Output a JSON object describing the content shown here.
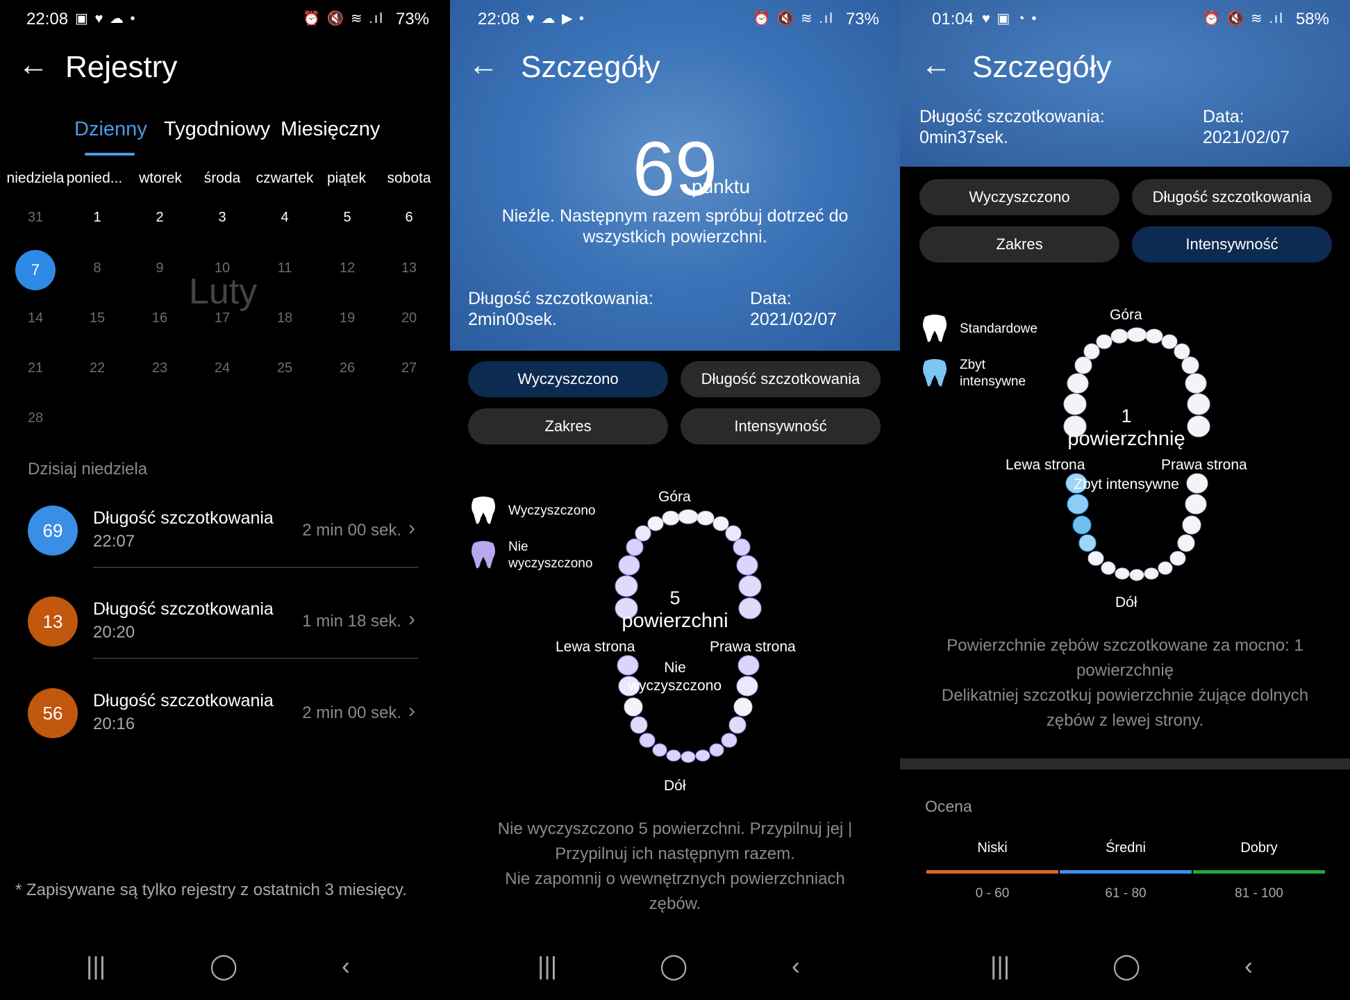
{
  "panel1": {
    "status": {
      "time": "22:08",
      "battery": "73%",
      "left_icons": "▣ ♥ ☁ •",
      "right_icons": "⏰ 🔇 ≋ .ıl"
    },
    "title": "Rejestry",
    "tabs": [
      "Dzienny",
      "Tygodniowy",
      "Miesięczny"
    ],
    "weekdays": [
      "niedziela",
      "ponied...",
      "wtorek",
      "środa",
      "czwartek",
      "piątek",
      "sobota"
    ],
    "days_row1": [
      "31",
      "1",
      "2",
      "3",
      "4",
      "5",
      "6"
    ],
    "selected_day": "7",
    "days_row2": [
      "8",
      "9",
      "10",
      "11",
      "12",
      "13"
    ],
    "days_row3": [
      "14",
      "15",
      "16",
      "17",
      "18",
      "19",
      "20"
    ],
    "days_row4": [
      "21",
      "22",
      "23",
      "24",
      "25",
      "26",
      "27"
    ],
    "days_row5": [
      "28"
    ],
    "month_watermark": "Luty",
    "today_label": "Dzisiaj   niedziela",
    "records": [
      {
        "score": "69",
        "title": "Długość szczotkowania",
        "time": "22:07",
        "duration": "2 min 00 sek.",
        "color": "#3a8ee6"
      },
      {
        "score": "13",
        "title": "Długość szczotkowania",
        "time": "20:20",
        "duration": "1 min 18 sek.",
        "color": "#c2570e"
      },
      {
        "score": "56",
        "title": "Długość szczotkowania",
        "time": "20:16",
        "duration": "2 min 00 sek.",
        "color": "#c2570e"
      }
    ],
    "footnote": "* Zapisywane są tylko rejestry z ostatnich 3 miesięcy."
  },
  "panel2": {
    "status": {
      "time": "22:08",
      "battery": "73%",
      "left_icons": "♥ ☁ ▶ •",
      "right_icons": "⏰ 🔇 ≋ .ıl"
    },
    "title": "Szczegóły",
    "score": "69",
    "score_unit": "punktu",
    "message_line1": "Nieźle. Następnym razem spróbuj dotrzeć do",
    "message_line2": "wszystkich powierzchni.",
    "duration_label": "Długość szczotkowania:",
    "duration_value": "2min00sek.",
    "date_label": "Data:",
    "date_value": "2021/02/07",
    "pills": [
      "Wyczyszczono",
      "Długość szczotkowania",
      "Zakres",
      "Intensywność"
    ],
    "legend": [
      {
        "text": "Wyczyszczono",
        "color": "#ffffff"
      },
      {
        "text_line1": "Nie",
        "text_line2": "wyczyszczono",
        "color": "#b7a6f0"
      }
    ],
    "chart": {
      "top": "Góra",
      "bottom": "Dół",
      "left": "Lewa strona",
      "right": "Prawa strona",
      "center_num": "5",
      "center_text": "powierzchni",
      "lower_line1": "Nie",
      "lower_line2": "wyczyszczono"
    },
    "notes": [
      "Nie wyczyszczono 5 powierzchni. Przypilnuj jej |",
      "Przypilnuj ich następnym razem.",
      "Nie zapomnij o wewnętrznych powierzchniach",
      "zębów."
    ]
  },
  "panel3": {
    "status": {
      "time": "01:04",
      "battery": "58%",
      "left_icons": "♥ ▣ ◔ •",
      "right_icons": "⏰ 🔇 ≋ .ıl"
    },
    "title": "Szczegóły",
    "duration_label": "Długość szczotkowania:",
    "duration_value": "0min37sek.",
    "date_label": "Data:",
    "date_value": "2021/02/07",
    "pills": [
      "Wyczyszczono",
      "Długość szczotkowania",
      "Zakres",
      "Intensywność"
    ],
    "legend": [
      {
        "text": "Standardowe",
        "color": "#ffffff"
      },
      {
        "text_line1": "Zbyt",
        "text_line2": "intensywne",
        "color": "#7cc6f2"
      }
    ],
    "chart": {
      "top": "Góra",
      "bottom": "Dół",
      "left": "Lewa strona",
      "right": "Prawa strona",
      "center_num": "1",
      "center_text": "powierzchnię",
      "lower": "Zbyt intensywne"
    },
    "notes": [
      "Powierzchnie zębów szczotkowane za mocno: 1",
      "powierzchnię",
      "Delikatniej szczotkuj powierzchnie żujące dolnych",
      "zębów z lewej strony."
    ],
    "rating_header": "Ocena",
    "ratings": [
      {
        "name": "Niski",
        "range": "0 - 60",
        "color": "#d7652a"
      },
      {
        "name": "Średni",
        "range": "61 - 80",
        "color": "#3a8ee6"
      },
      {
        "name": "Dobry",
        "range": "81 - 100",
        "color": "#27a53a"
      }
    ]
  },
  "nav": {
    "recent": "|||",
    "home": "◯",
    "back": "‹"
  }
}
